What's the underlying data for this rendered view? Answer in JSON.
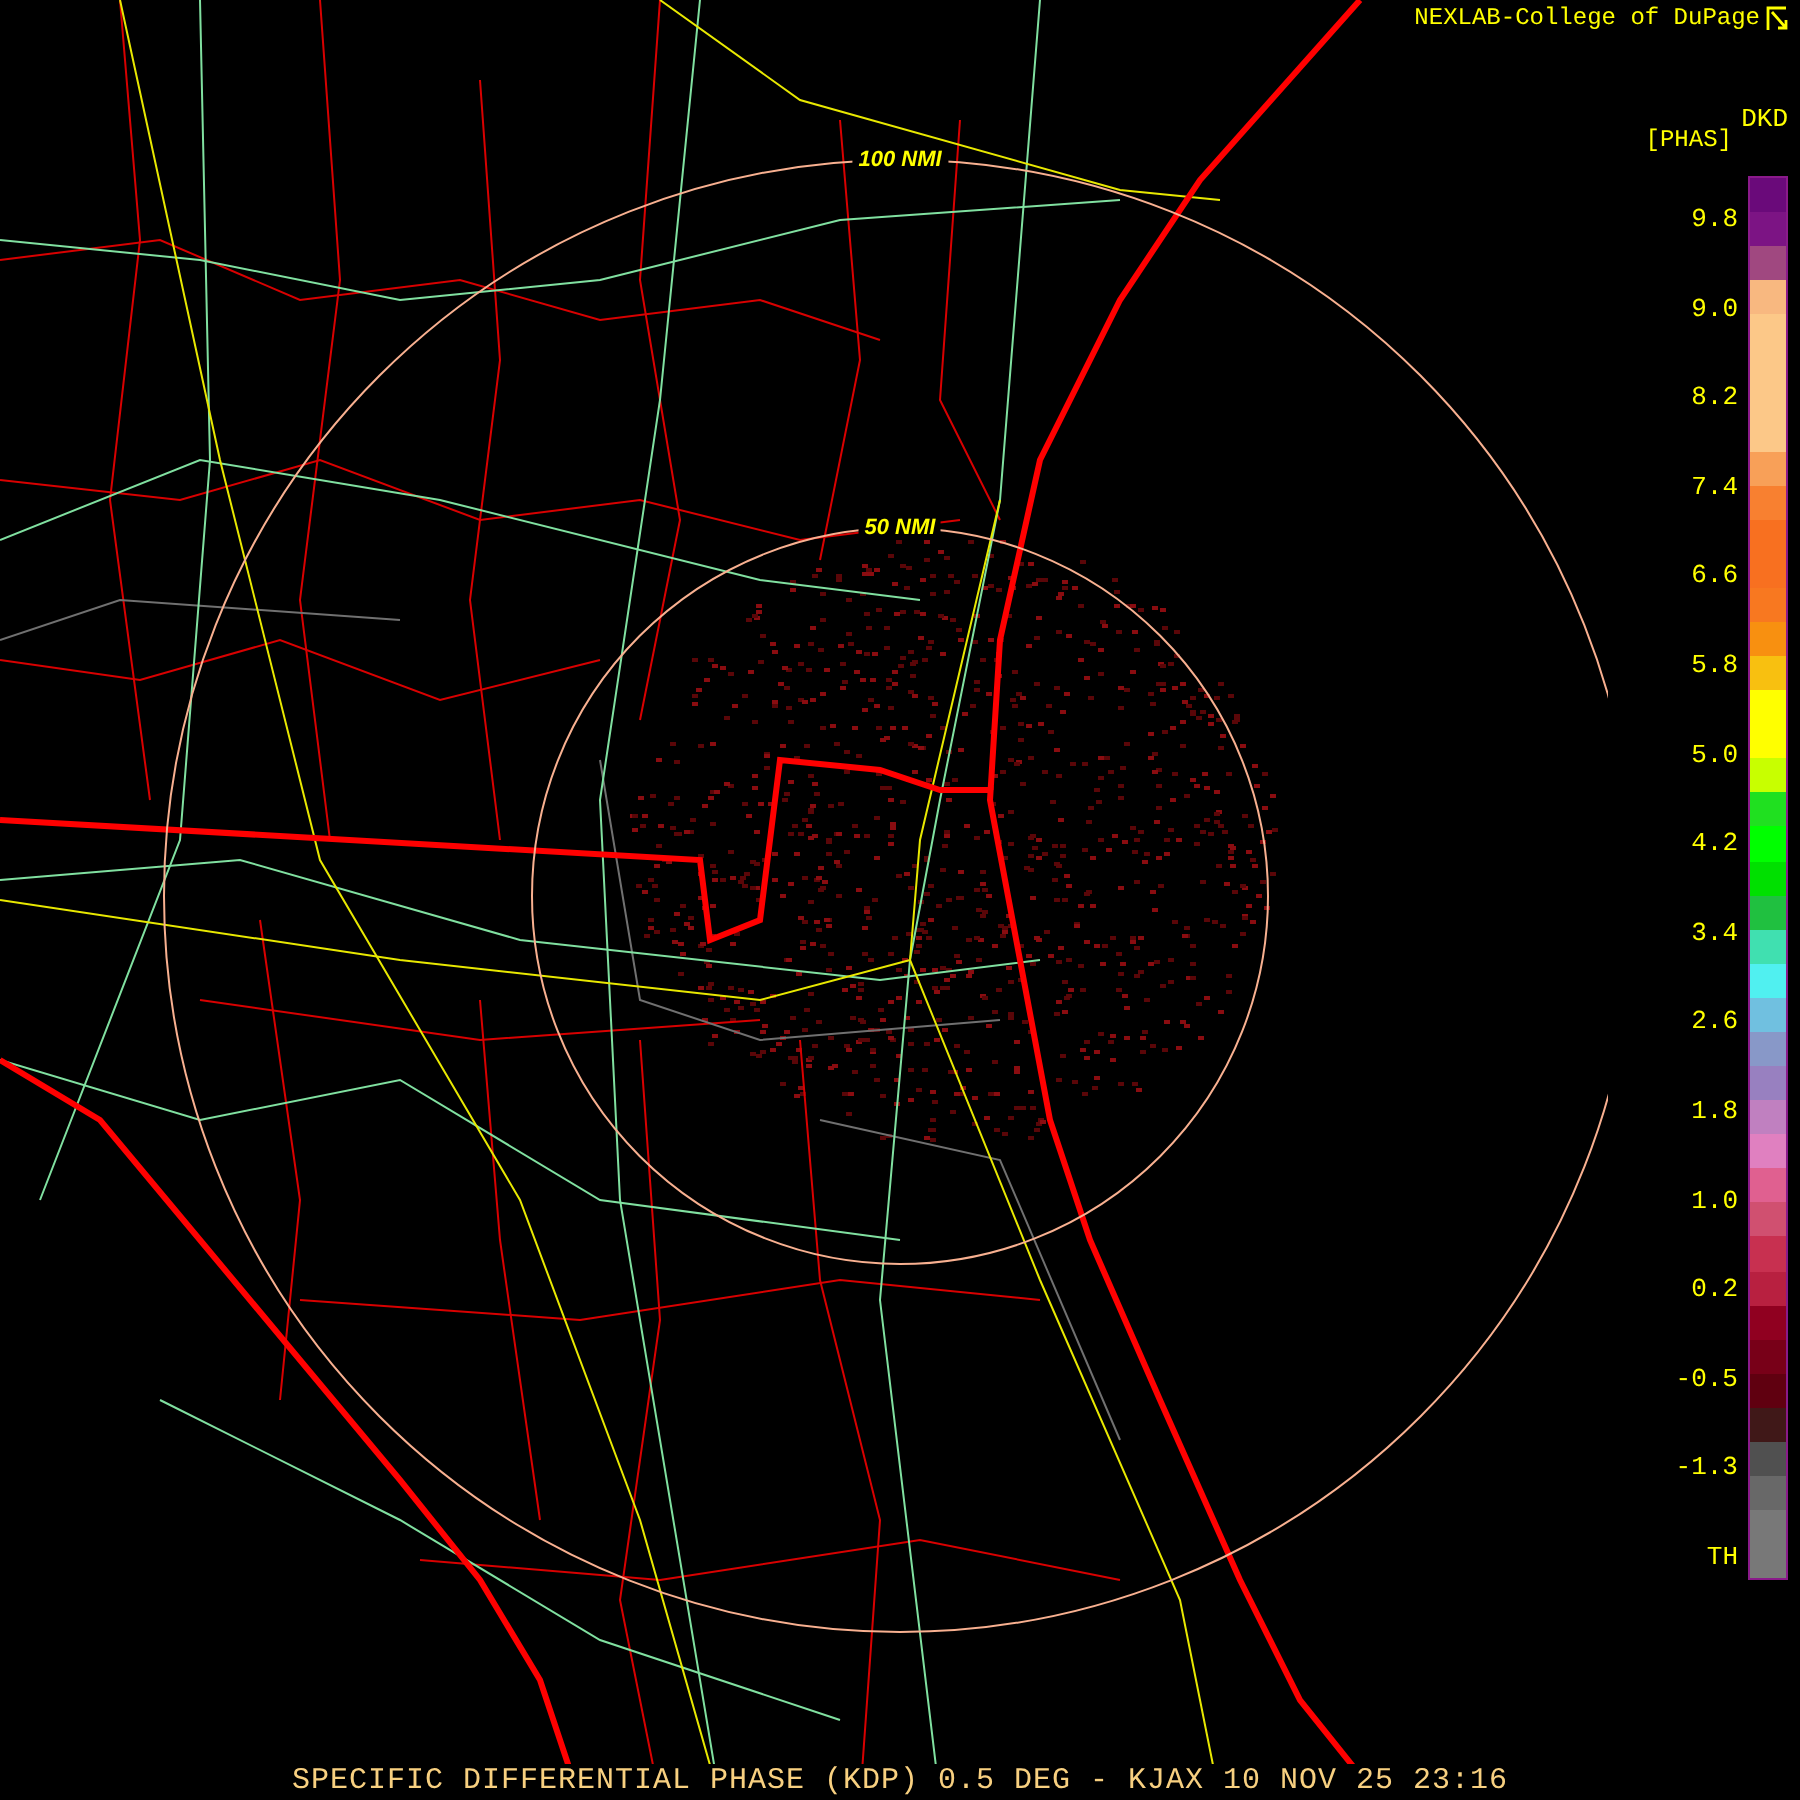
{
  "header": {
    "credit": "NEXLAB-College of DuPage"
  },
  "map": {
    "range_rings": [
      {
        "label": "100 NMI",
        "kind": "outer"
      },
      {
        "label": "50 NMI",
        "kind": "inner"
      }
    ]
  },
  "legend": {
    "product": "DKD",
    "unit": "[PHAS]",
    "ticks": [
      "9.8",
      "9.0",
      "8.2",
      "7.4",
      "6.6",
      "5.8",
      "5.0",
      "4.2",
      "3.4",
      "2.6",
      "1.8",
      "1.0",
      "0.2",
      "-0.5",
      "-1.3",
      "TH"
    ],
    "bins": [
      {
        "color": "#6a0a7a"
      },
      {
        "color": "#7c1484"
      },
      {
        "color": "#a04880"
      },
      {
        "color": "#f8b880"
      },
      {
        "color": "#fcc888"
      },
      {
        "color": "#fcc888"
      },
      {
        "color": "#fcc888"
      },
      {
        "color": "#fcc888"
      },
      {
        "color": "#f8a058"
      },
      {
        "color": "#f88030"
      },
      {
        "color": "#f87020"
      },
      {
        "color": "#f87020"
      },
      {
        "color": "#f87820"
      },
      {
        "color": "#f89010"
      },
      {
        "color": "#f8c010"
      },
      {
        "color": "#ffff00"
      },
      {
        "color": "#ffff00"
      },
      {
        "color": "#c8ff00"
      },
      {
        "color": "#20e020"
      },
      {
        "color": "#00ff00"
      },
      {
        "color": "#00e000"
      },
      {
        "color": "#20c040"
      },
      {
        "color": "#40e0b0"
      },
      {
        "color": "#50f0f0"
      },
      {
        "color": "#70c0e0"
      },
      {
        "color": "#8898c8"
      },
      {
        "color": "#9880c0"
      },
      {
        "color": "#c080c0"
      },
      {
        "color": "#e080c0"
      },
      {
        "color": "#e06090"
      },
      {
        "color": "#d05070"
      },
      {
        "color": "#c83050"
      },
      {
        "color": "#b82040"
      },
      {
        "color": "#900020"
      },
      {
        "color": "#780018"
      },
      {
        "color": "#600010"
      },
      {
        "color": "#401818"
      },
      {
        "color": "#505050"
      },
      {
        "color": "#686868"
      },
      {
        "color": "#787878"
      },
      {
        "color": "#787878"
      }
    ]
  },
  "footer": {
    "caption": "SPECIFIC DIFFERENTIAL PHASE (KDP) 0.5 DEG - KJAX 10 NOV 25 23:16"
  }
}
